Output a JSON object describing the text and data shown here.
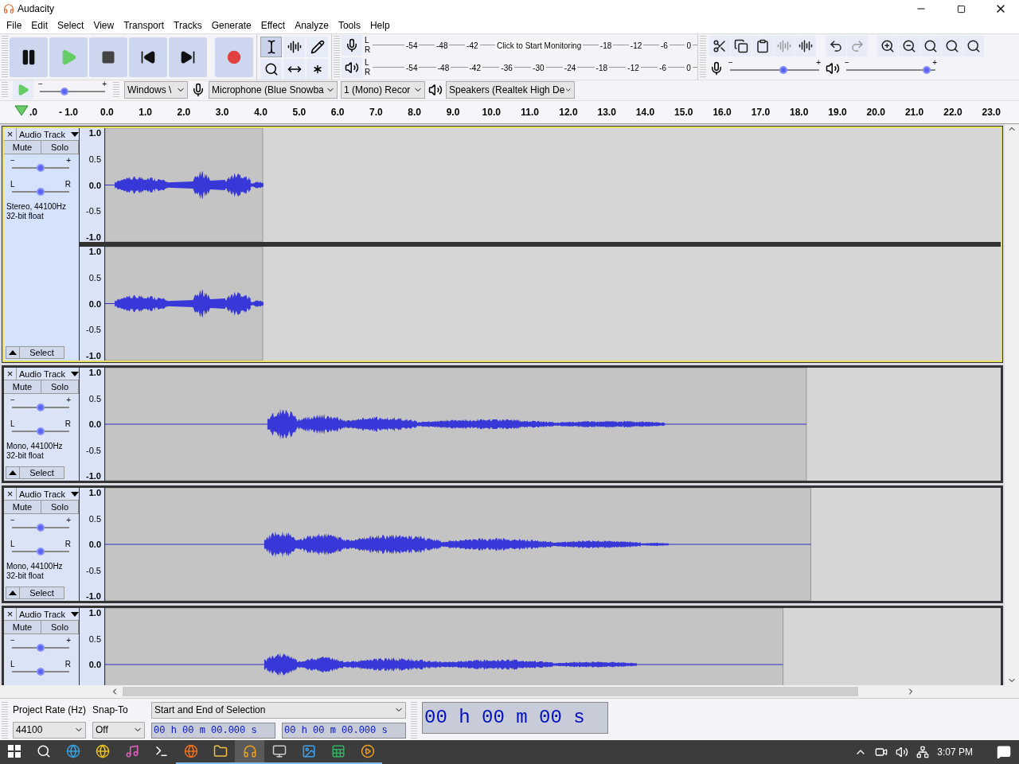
{
  "window": {
    "title": "Audacity"
  },
  "menu": [
    "File",
    "Edit",
    "Select",
    "View",
    "Transport",
    "Tracks",
    "Generate",
    "Effect",
    "Analyze",
    "Tools",
    "Help"
  ],
  "transport": [
    {
      "kind": "pause"
    },
    {
      "kind": "play"
    },
    {
      "kind": "stop"
    },
    {
      "kind": "skip-start"
    },
    {
      "kind": "skip-end"
    },
    {
      "kind": "record"
    }
  ],
  "tools": [
    {
      "kind": "select",
      "selected": true
    },
    {
      "kind": "envelope",
      "selected": false
    },
    {
      "kind": "draw",
      "selected": false
    },
    {
      "kind": "zoom",
      "selected": false
    },
    {
      "kind": "time-shift",
      "selected": false
    },
    {
      "kind": "multi",
      "selected": false
    }
  ],
  "recording_meter": {
    "labels": [
      "-54",
      "-48",
      "-42",
      "Click to Start Monitoring",
      "-18",
      "-12",
      "-6",
      "0"
    ]
  },
  "playback_meter": {
    "labels": [
      "-54",
      "-48",
      "-42",
      "-36",
      "-30",
      "-24",
      "-18",
      "-12",
      "-6",
      "0"
    ]
  },
  "channel_labels": [
    "L",
    "R",
    "L",
    "R"
  ],
  "edit_buttons": [
    {
      "kind": "cut",
      "disabled": false
    },
    {
      "kind": "copy",
      "disabled": false
    },
    {
      "kind": "paste",
      "disabled": false
    },
    {
      "kind": "trim",
      "disabled": true
    },
    {
      "kind": "silence",
      "disabled": false
    },
    {
      "kind": "undo",
      "disabled": false
    },
    {
      "kind": "redo",
      "disabled": true
    },
    {
      "kind": "zoom-in",
      "disabled": false
    },
    {
      "kind": "zoom-out",
      "disabled": false
    },
    {
      "kind": "fit-selection",
      "disabled": false
    },
    {
      "kind": "fit-project",
      "disabled": false
    },
    {
      "kind": "zoom-toggle",
      "disabled": false
    }
  ],
  "mixer": {
    "recording": {
      "level": 0.6
    },
    "playback": {
      "level": 0.9
    },
    "minus": [
      "−",
      "−"
    ],
    "plus": [
      "+",
      "+"
    ]
  },
  "play_at_speed": {
    "level": 0.38,
    "minus": "−",
    "plus": "+"
  },
  "devices": {
    "host": "Windows \\",
    "microphone": "Microphone (Blue Snowba",
    "channels": "1 (Mono) Recor",
    "speakers": "Speakers (Realtek High De"
  },
  "ruler": {
    "ticks": [
      ".0",
      "- 1.0",
      "0.0",
      "1.0",
      "2.0",
      "3.0",
      "4.0",
      "5.0",
      "6.0",
      "7.0",
      "8.0",
      "9.0",
      "10.0",
      "11.0",
      "12.0",
      "13.0",
      "14.0",
      "15.0",
      "16.0",
      "17.0",
      "18.0",
      "19.0",
      "20.0",
      "21.0",
      "22.0",
      "23.0"
    ]
  },
  "tracks": [
    {
      "name": "Audio Track",
      "close": "×",
      "mute": "Mute",
      "solo": "Solo",
      "gain": {
        "level": 0.5
      },
      "pan": {
        "level": 0.5
      },
      "gain_minus": "−",
      "gain_plus": "+",
      "pan_left": "L",
      "pan_right": "R",
      "info": [
        "Stereo, 44100Hz",
        "32-bit float"
      ],
      "select": "Select",
      "selected": true,
      "channels": [
        {
          "scale": [
            "1.0",
            "0.5",
            "0.0",
            "-0.5",
            "-1.0"
          ]
        },
        {
          "scale": [
            "1.0",
            "0.5",
            "0.0",
            "-0.5",
            "-1.0"
          ]
        }
      ]
    },
    {
      "name": "Audio Track",
      "close": "×",
      "mute": "Mute",
      "solo": "Solo",
      "gain": {
        "level": 0.5
      },
      "pan": {
        "level": 0.5
      },
      "gain_minus": "−",
      "gain_plus": "+",
      "pan_left": "L",
      "pan_right": "R",
      "info": [
        "Mono, 44100Hz",
        "32-bit float"
      ],
      "select": "Select",
      "selected": false,
      "channels": [
        {
          "scale": [
            "1.0",
            "0.5",
            "0.0",
            "-0.5",
            "-1.0"
          ]
        }
      ]
    },
    {
      "name": "Audio Track",
      "close": "×",
      "mute": "Mute",
      "solo": "Solo",
      "gain": {
        "level": 0.5
      },
      "pan": {
        "level": 0.5
      },
      "gain_minus": "−",
      "gain_plus": "+",
      "pan_left": "L",
      "pan_right": "R",
      "info": [
        "Mono, 44100Hz",
        "32-bit float"
      ],
      "select": "Select",
      "selected": false,
      "channels": [
        {
          "scale": [
            "1.0",
            "0.5",
            "0.0",
            "-0.5",
            "-1.0"
          ]
        }
      ]
    },
    {
      "name": "Audio Track",
      "close": "×",
      "mute": "Mute",
      "solo": "Solo",
      "gain": {
        "level": 0.5
      },
      "pan": {
        "level": 0.5
      },
      "gain_minus": "−",
      "gain_plus": "+",
      "pan_left": "L",
      "pan_right": "R",
      "selected": false,
      "channels": [
        {
          "scale": [
            "1.0",
            "0.5",
            "0.0"
          ]
        }
      ]
    }
  ],
  "selection_bar": {
    "rate_label": "Project Rate (Hz)",
    "rate": "44100",
    "snap_label": "Snap-To",
    "snap": "Off",
    "mode": "Start and End of Selection",
    "start": "00 h 00 m 00.000 s",
    "end": "00 h 00 m 00.000 s",
    "audio_position": "00 h 00 m 00 s"
  },
  "taskbar": {
    "apps": [
      {
        "kind": "edge",
        "running": false,
        "selected": false
      },
      {
        "kind": "chrome",
        "running": false,
        "selected": false
      },
      {
        "kind": "music",
        "running": false,
        "selected": false
      },
      {
        "kind": "terminal",
        "running": false,
        "selected": false
      },
      {
        "kind": "firefox",
        "running": true,
        "selected": false
      },
      {
        "kind": "folder",
        "running": true,
        "selected": false
      },
      {
        "kind": "audacity",
        "running": true,
        "selected": true
      },
      {
        "kind": "monitor",
        "running": true,
        "selected": false
      },
      {
        "kind": "photos",
        "running": true,
        "selected": false
      },
      {
        "kind": "excel",
        "running": true,
        "selected": false
      },
      {
        "kind": "player",
        "running": true,
        "selected": false
      }
    ],
    "time": "3:07 PM"
  }
}
